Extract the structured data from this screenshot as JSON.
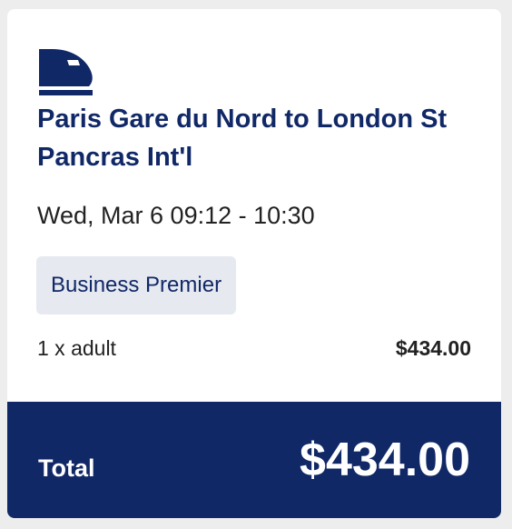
{
  "trip": {
    "icon": "train-icon",
    "route": "Paris Gare du Nord to London St Pancras Int'l",
    "datetime": "Wed, Mar 6 09:12 - 10:30",
    "fare_class": "Business Premier"
  },
  "fare": {
    "passenger": "1 x adult",
    "price": "$434.00"
  },
  "total": {
    "label": "Total",
    "price": "$434.00"
  },
  "colors": {
    "brand_navy": "#112867",
    "badge_bg": "#e6e9f0",
    "text": "#222222",
    "background": "#ededed"
  }
}
